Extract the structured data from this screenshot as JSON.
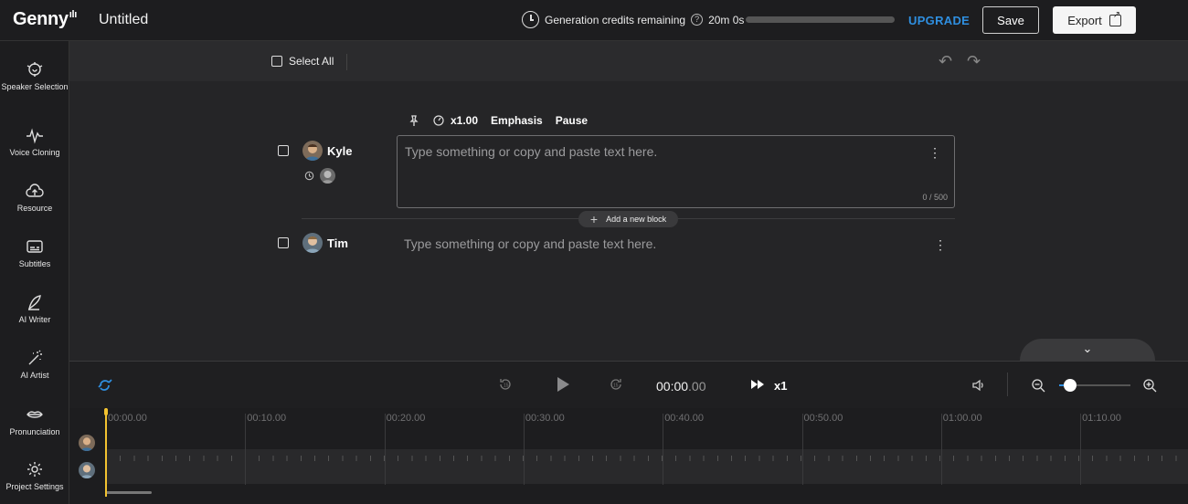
{
  "app": {
    "logo": "Genny",
    "logo_mark": "ılı",
    "document_title": "Untitled"
  },
  "credits": {
    "label": "Generation credits remaining",
    "help": "?",
    "remaining": "20m 0s",
    "used_fraction": 0.0
  },
  "actions": {
    "upgrade": "UPGRADE",
    "save": "Save",
    "export": "Export"
  },
  "sidebar": {
    "items": [
      {
        "label": "Speaker Selection",
        "icon": "speaker-selection-icon"
      },
      {
        "label": "Voice Cloning",
        "icon": "voice-cloning-icon"
      },
      {
        "label": "Resource",
        "icon": "cloud-upload-icon"
      },
      {
        "label": "Subtitles",
        "icon": "subtitles-icon"
      },
      {
        "label": "AI Writer",
        "icon": "pen-icon"
      },
      {
        "label": "AI Artist",
        "icon": "magic-wand-icon"
      },
      {
        "label": "Pronunciation",
        "icon": "lips-icon"
      },
      {
        "label": "Project Settings",
        "icon": "gear-icon"
      }
    ]
  },
  "toolbar": {
    "select_all": "Select All",
    "undo": "↶",
    "redo": "↷"
  },
  "block_tools": {
    "speed": "x1.00",
    "emphasis": "Emphasis",
    "pause": "Pause"
  },
  "blocks": [
    {
      "speaker": "Kyle",
      "placeholder": "Type something or copy and paste text here.",
      "counter": "0 / 500"
    },
    {
      "speaker": "Tim",
      "placeholder": "Type something or copy and paste text here."
    }
  ],
  "add_block": {
    "plus": "+",
    "label": "Add a new block"
  },
  "collapse": "⌄",
  "player": {
    "time_main": "00:00",
    "time_ms": ".00",
    "speed": "x1",
    "zoom_level": 0.15
  },
  "timeline": {
    "ticks": [
      "00:00.00",
      "00:10.00",
      "00:20.00",
      "00:30.00",
      "00:40.00",
      "00:50.00",
      "01:00.00",
      "01:10.00"
    ]
  },
  "colors": {
    "accent": "#2f8fe0",
    "playhead": "#f2c230",
    "background": "#252527"
  }
}
